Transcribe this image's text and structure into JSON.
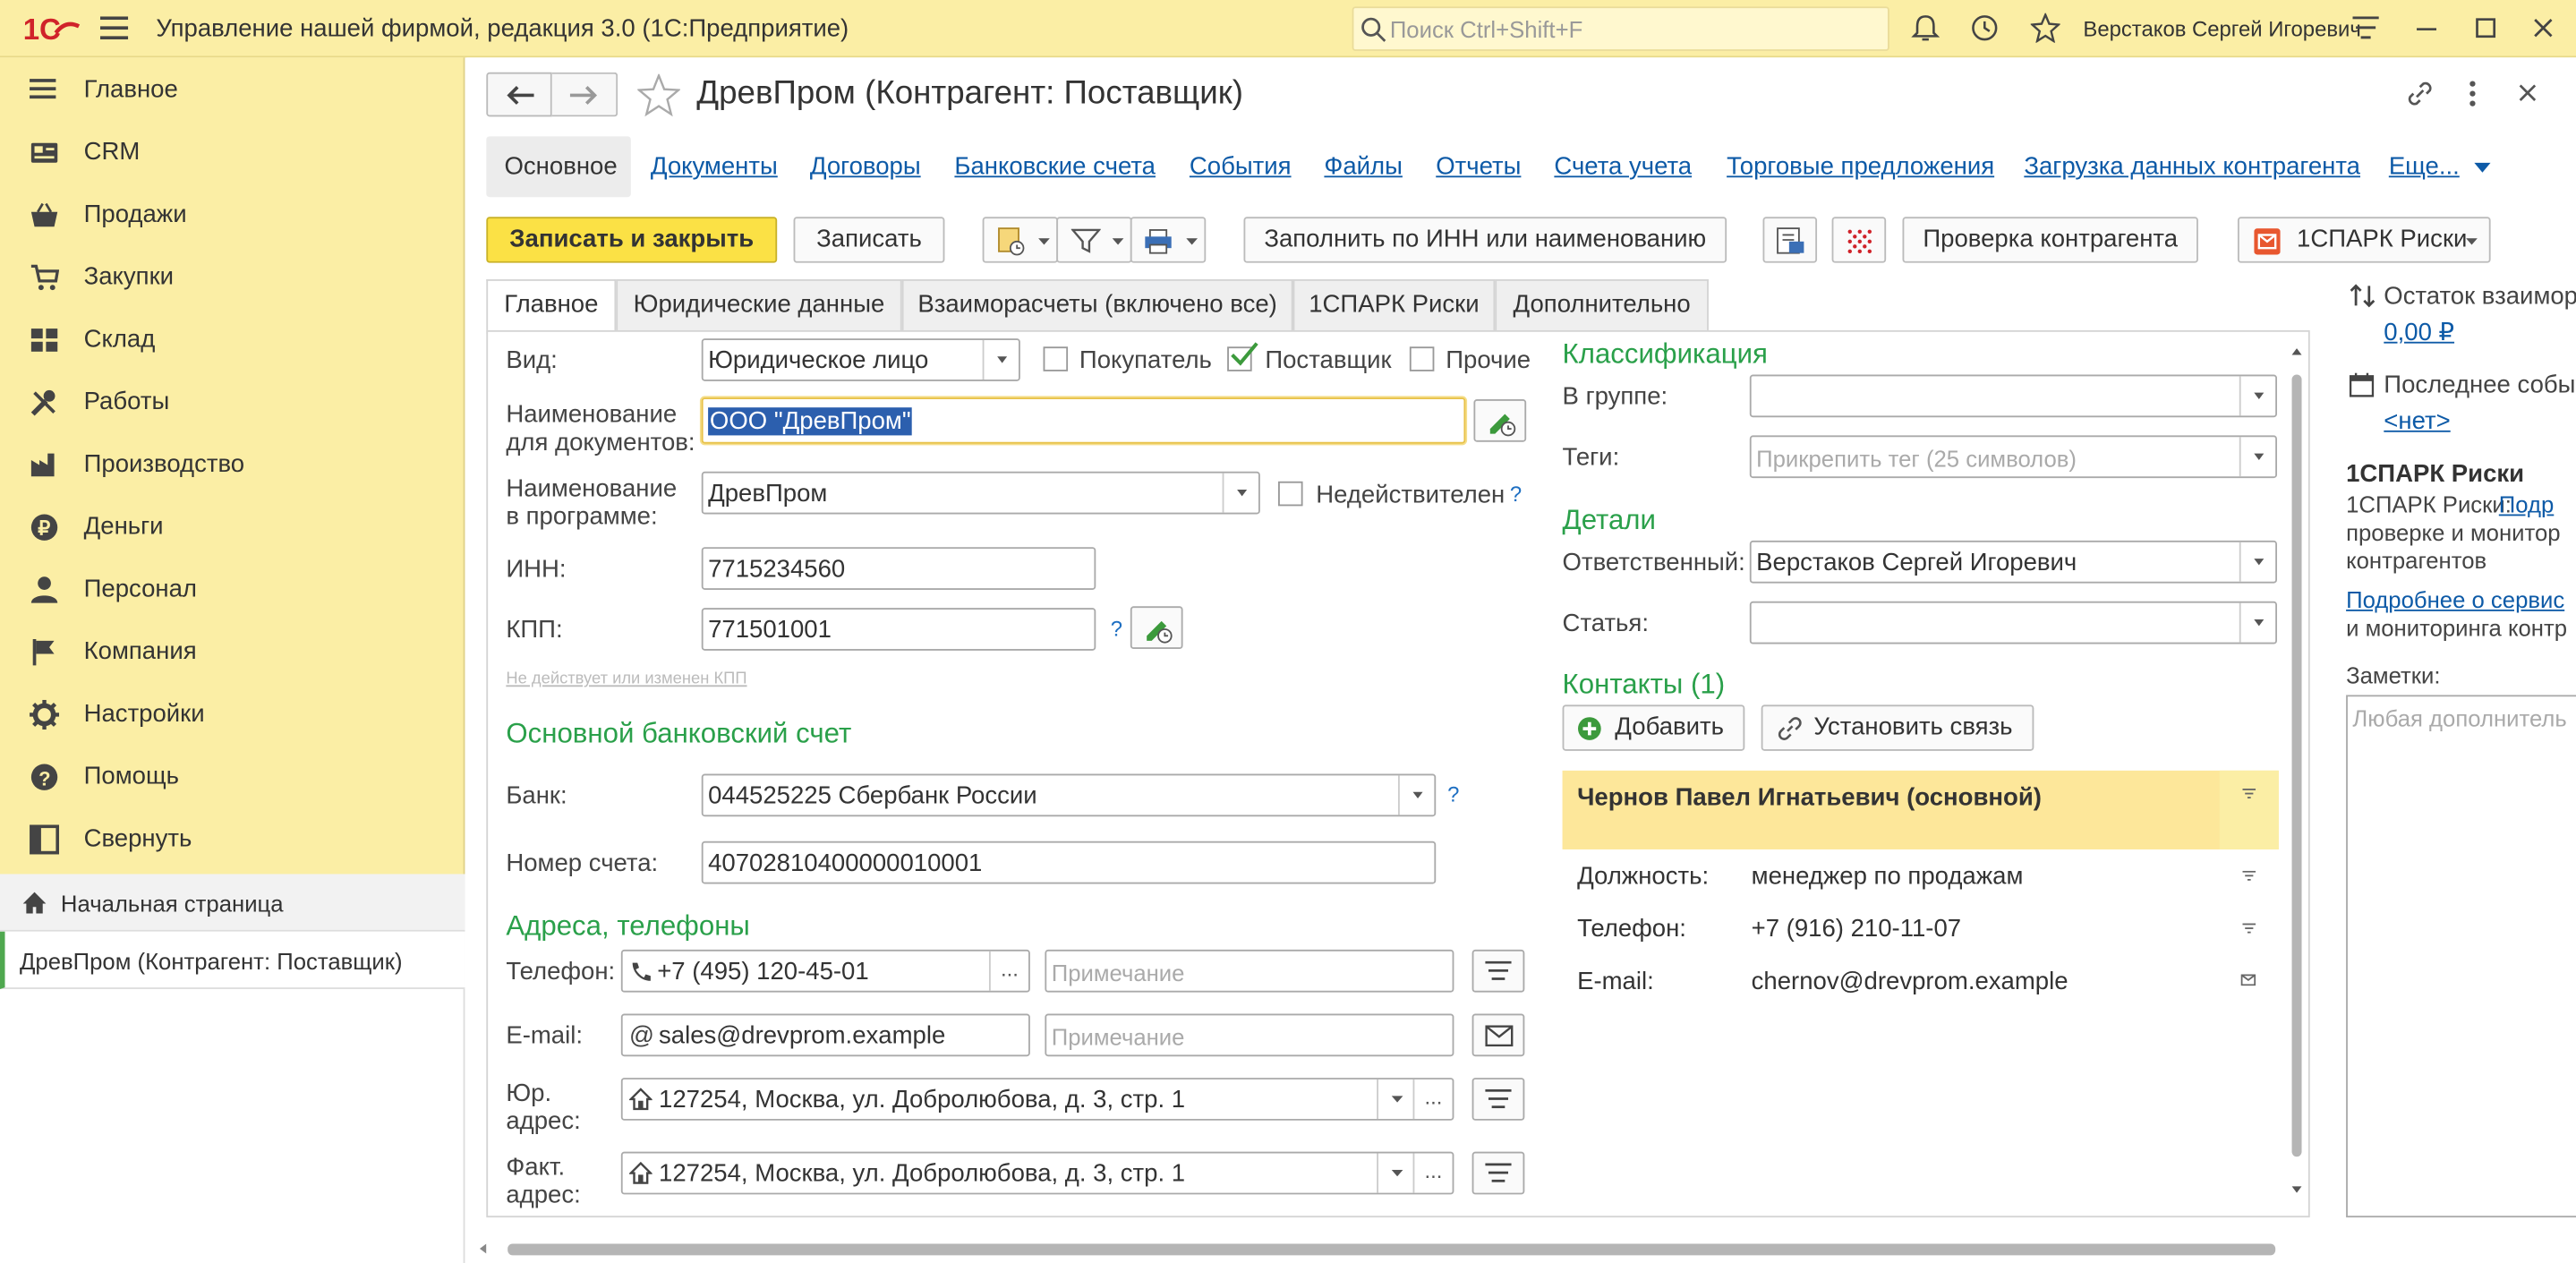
{
  "topbar": {
    "app_title": "Управление нашей фирмой, редакция 3.0  (1С:Предприятие)",
    "search_placeholder": "Поиск Ctrl+Shift+F",
    "user": "Верстаков Сергей Игоревич"
  },
  "sidebar": {
    "items": [
      {
        "label": "Главное",
        "icon": "menu-icon"
      },
      {
        "label": "CRM",
        "icon": "crm-icon"
      },
      {
        "label": "Продажи",
        "icon": "basket-icon"
      },
      {
        "label": "Закупки",
        "icon": "cart-icon"
      },
      {
        "label": "Склад",
        "icon": "warehouse-icon"
      },
      {
        "label": "Работы",
        "icon": "tools-icon"
      },
      {
        "label": "Производство",
        "icon": "factory-icon"
      },
      {
        "label": "Деньги",
        "icon": "ruble-icon"
      },
      {
        "label": "Персонал",
        "icon": "person-icon"
      },
      {
        "label": "Компания",
        "icon": "flag-icon"
      },
      {
        "label": "Настройки",
        "icon": "gear-icon"
      },
      {
        "label": "Помощь",
        "icon": "help-icon"
      },
      {
        "label": "Свернуть",
        "icon": "collapse-icon"
      }
    ],
    "home_page": "Начальная страница",
    "current_doc": "ДревПром (Контрагент: Поставщик)"
  },
  "header": {
    "title": "ДревПром (Контрагент: Поставщик)",
    "tabs": {
      "main": "Основное",
      "links": [
        "Документы",
        "Договоры",
        "Банковские счета",
        "События",
        "Файлы",
        "Отчеты",
        "Счета учета",
        "Торговые предложения",
        "Загрузка данных контрагента",
        "Еще..."
      ]
    }
  },
  "toolbar": {
    "save_close": "Записать и закрыть",
    "save": "Записать",
    "fill_inn": "Заполнить по ИНН или наименованию",
    "check": "Проверка контрагента",
    "spark": "1СПАРК Риски"
  },
  "form_tabs": [
    "Главное",
    "Юридические данные",
    "Взаиморасчеты (включено все)",
    "1СПАРК Риски",
    "Дополнительно"
  ],
  "form": {
    "vid_label": "Вид:",
    "vid_value": "Юридическое лицо",
    "buyer": "Покупатель",
    "supplier": "Поставщик",
    "other": "Прочие",
    "name_doc_label_1": "Наименование",
    "name_doc_label_2": "для документов:",
    "name_doc_value": "ООО \"ДревПром\"",
    "name_prog_label_1": "Наименование",
    "name_prog_label_2": "в программе:",
    "name_prog_value": "ДревПром",
    "invalid": "Недействителен",
    "inn_label": "ИНН:",
    "inn_value": "7715234560",
    "kpp_label": "КПП:",
    "kpp_value": "771501001",
    "kpp_hint": "Не действует или изменен КПП",
    "bank_section": "Основной банковский счет",
    "bank_label": "Банк:",
    "bank_value": "044525225 Сбербанк России",
    "account_label": "Номер счета:",
    "account_value": "40702810400000010001",
    "address_section": "Адреса, телефоны",
    "phone_label": "Телефон:",
    "phone_value": "+7 (495) 120-45-01",
    "note_placeholder": "Примечание",
    "email_label": "E-mail:",
    "email_value": "sales@drevprom.example",
    "legal_addr_label_1": "Юр.",
    "legal_addr_label_2": "адрес:",
    "legal_addr_value": "127254, Москва, ул. Добролюбова, д. 3, стр. 1",
    "fact_addr_label_1": "Факт.",
    "fact_addr_label_2": "адрес:",
    "fact_addr_value": "127254, Москва, ул. Добролюбова, д. 3, стр. 1",
    "dots": "...",
    "question": "?"
  },
  "classification": {
    "section": "Классификация",
    "group_label": "В группе:",
    "tags_label": "Теги:",
    "tags_placeholder": "Прикрепить тег (25 символов)",
    "details_section": "Детали",
    "responsible_label": "Ответственный:",
    "responsible_value": "Верстаков Сергей Игоревич",
    "article_label": "Статья:",
    "contacts_section": "Контакты (1)",
    "add_button": "Добавить",
    "link_button": "Установить связь",
    "contact_name": "Чернов Павел Игнатьевич (основной)",
    "position_label": "Должность:",
    "position_value": "менеджер по продажам",
    "phone_label": "Телефон:",
    "phone_value": "+7 (916) 210-11-07",
    "email_label": "E-mail:",
    "email_value": "chernov@drevprom.example"
  },
  "rightpanel": {
    "balance_label": "Остаток взаимор",
    "balance_value": "0,00 ₽",
    "last_event_label": "Последнее событ",
    "last_event_value": "<нет>",
    "spark_title": "1СПАРК Риски",
    "spark_text_1": "1СПАРК Риски:",
    "spark_link_1": "Подр",
    "spark_text_2": "проверке и монитор",
    "spark_text_3": "контрагентов",
    "spark_link_2": "Подробнее о сервис",
    "spark_text_4": "и мониторинга контр",
    "notes_label": "Заметки:",
    "notes_placeholder": "Любая дополнитель"
  },
  "colors": {
    "topbar_bg": "#fbeea5",
    "accent_yellow": "#fbe145",
    "link": "#0d5aa7",
    "section_green": "#2aa04a",
    "contact_highlight": "#fde79a"
  }
}
